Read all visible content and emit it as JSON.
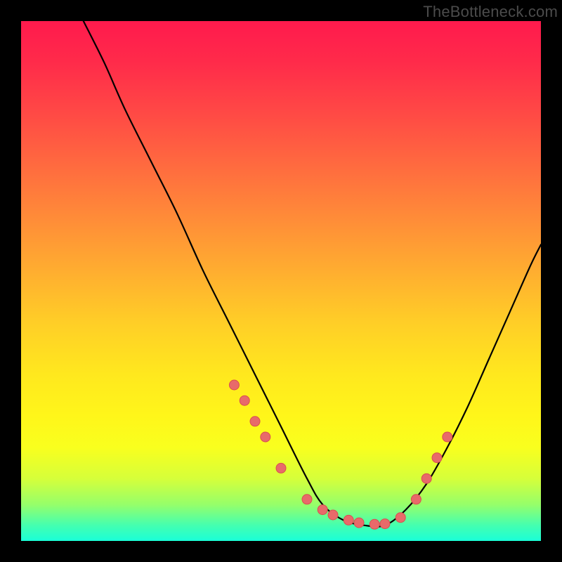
{
  "watermark": "TheBottleneck.com",
  "colors": {
    "background": "#000000",
    "curve_stroke": "#000000",
    "marker_fill": "#e86a6a",
    "marker_stroke": "#d94f4f"
  },
  "chart_data": {
    "type": "line",
    "title": "",
    "xlabel": "",
    "ylabel": "",
    "xlim": [
      0,
      100
    ],
    "ylim": [
      0,
      100
    ],
    "grid": false,
    "legend": false,
    "description": "Bottleneck-style V-curve. Left arm descends steeply from top-left toward a flat trough near the bottom (~y=3) between roughly x=55 and x=70, then right arm rises with moderate slope toward upper-right. Pink dot markers cluster along the lower portions of both arms and across the trough.",
    "series": [
      {
        "name": "curve",
        "x": [
          12,
          16,
          20,
          25,
          30,
          35,
          40,
          45,
          50,
          55,
          58,
          62,
          66,
          70,
          74,
          78,
          82,
          86,
          90,
          94,
          98,
          100
        ],
        "y": [
          100,
          92,
          83,
          73,
          63,
          52,
          42,
          32,
          22,
          12,
          7,
          4,
          3,
          3,
          6,
          11,
          18,
          26,
          35,
          44,
          53,
          57
        ]
      },
      {
        "name": "markers",
        "x": [
          41,
          43,
          45,
          47,
          50,
          55,
          58,
          60,
          63,
          65,
          68,
          70,
          73,
          76,
          78,
          80,
          82
        ],
        "y": [
          30,
          27,
          23,
          20,
          14,
          8,
          6,
          5,
          4,
          3.5,
          3.2,
          3.3,
          4.5,
          8,
          12,
          16,
          20
        ]
      }
    ]
  }
}
